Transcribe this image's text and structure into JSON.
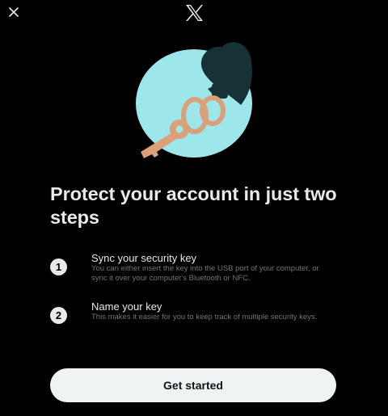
{
  "header": {
    "close_icon": "close-icon",
    "logo_icon": "x-logo-icon"
  },
  "illustration": {
    "name": "security-key-illustration",
    "colors": {
      "circle": "#9de6ea",
      "key": "#d9a07a",
      "fob": "#173236"
    }
  },
  "main": {
    "title": "Protect your account in just two steps",
    "steps": [
      {
        "number": "1",
        "title": "Sync your security key",
        "description": "You can either insert the key into the USB port of your computer, or sync it over your computer's Bluetooth or NFC."
      },
      {
        "number": "2",
        "title": "Name your key",
        "description": "This makes it easier for you to keep track of multiple security keys."
      }
    ]
  },
  "footer": {
    "cta_label": "Get started"
  }
}
